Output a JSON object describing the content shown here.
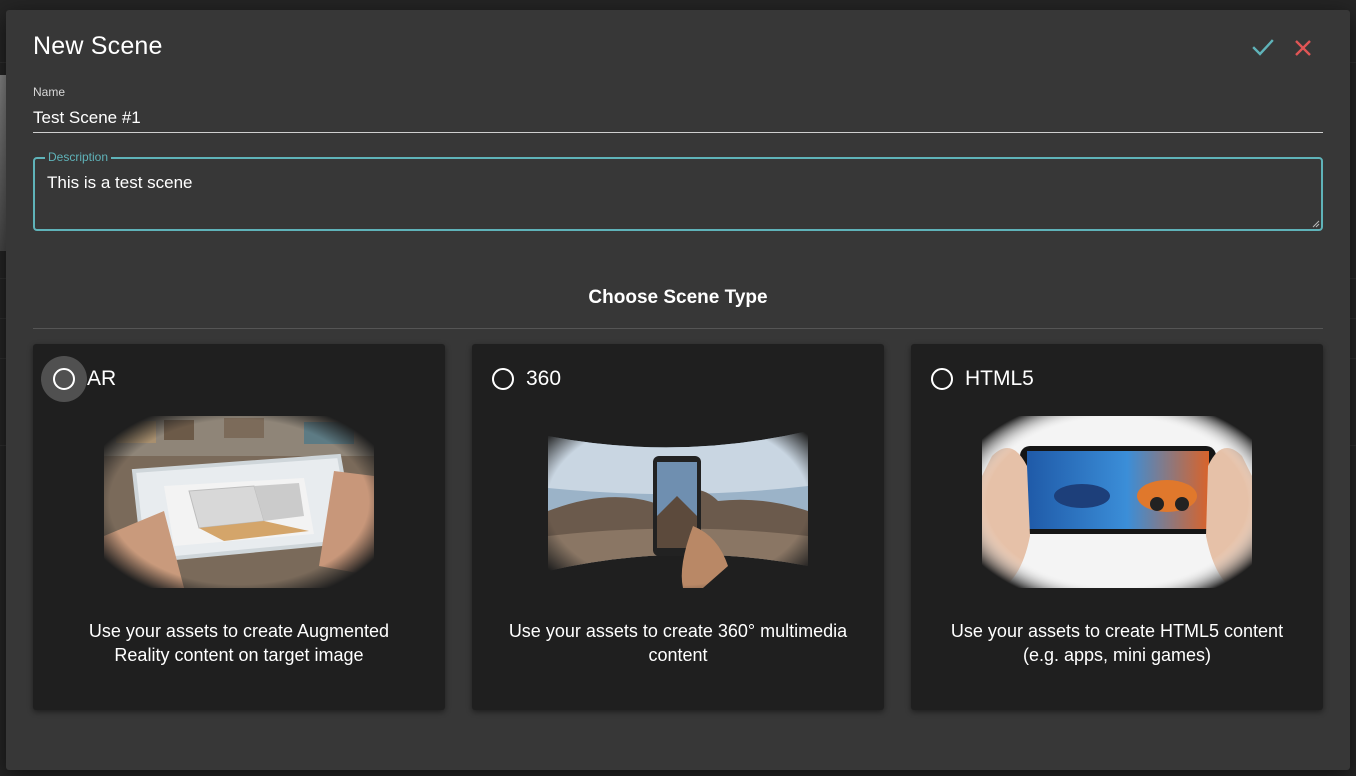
{
  "dialog": {
    "title": "New Scene",
    "confirm_icon": "check-icon",
    "close_icon": "close-icon",
    "accent_color": "#5fb3b9",
    "confirm_color": "#5fb3b9",
    "close_color": "#e05555"
  },
  "name_field": {
    "label": "Name",
    "value": "Test Scene #1"
  },
  "description_field": {
    "label": "Description",
    "value": "This is a test scene"
  },
  "scene_type": {
    "title": "Choose Scene Type",
    "options": [
      {
        "label": "AR",
        "description": "Use your assets to create Augmented Reality content on target image",
        "selected": false
      },
      {
        "label": "360",
        "description": "Use your assets to create 360° multimedia content",
        "selected": false
      },
      {
        "label": "HTML5",
        "description": "Use your assets to create HTML5 content (e.g. apps, mini games)",
        "selected": false
      }
    ]
  }
}
